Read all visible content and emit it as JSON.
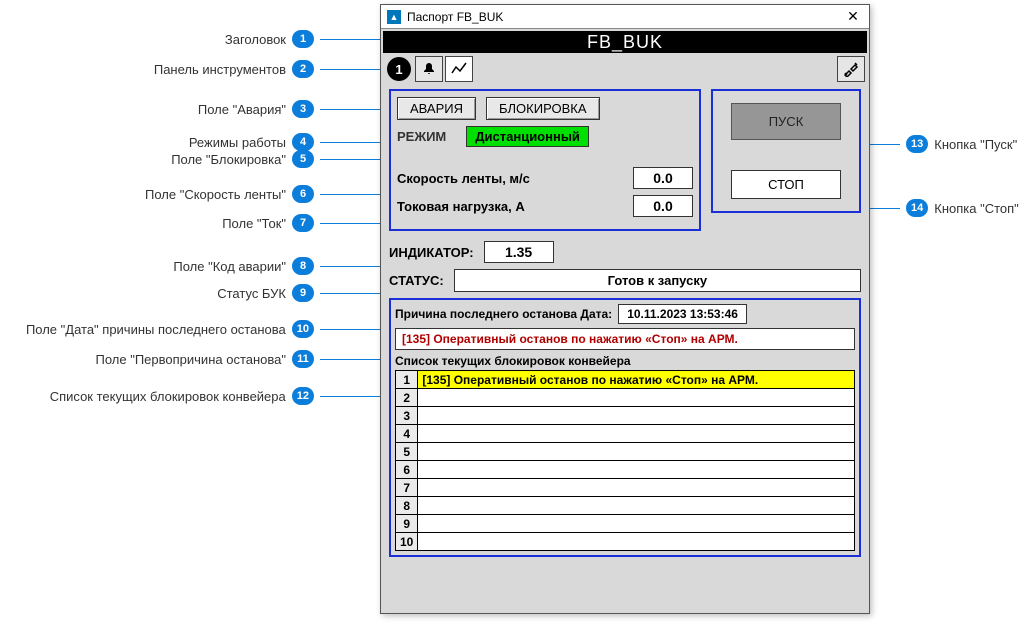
{
  "callouts_left": [
    {
      "num": "1",
      "label": "Заголовок"
    },
    {
      "num": "2",
      "label": "Панель инструментов"
    },
    {
      "num": "3",
      "label": "Поле \"Авария\""
    },
    {
      "num": "4",
      "label": "Режимы работы"
    },
    {
      "num": "5",
      "label": "Поле \"Блокировка\""
    },
    {
      "num": "6",
      "label": "Поле \"Скорость ленты\""
    },
    {
      "num": "7",
      "label": "Поле \"Ток\""
    },
    {
      "num": "8",
      "label": "Поле \"Код аварии\""
    },
    {
      "num": "9",
      "label": "Статус БУК"
    },
    {
      "num": "10",
      "label": "Поле \"Дата\" причины последнего останова"
    },
    {
      "num": "11",
      "label": "Поле \"Первопричина останова\""
    },
    {
      "num": "12",
      "label": "Список текущих блокировок конвейера"
    }
  ],
  "callouts_right": [
    {
      "num": "13",
      "label": "Кнопка \"Пуск\""
    },
    {
      "num": "14",
      "label": "Кнопка \"Стоп\""
    }
  ],
  "window": {
    "title": "Паспорт FB_BUK",
    "header": "FB_BUK",
    "toolbar": {
      "circle_num": "1"
    },
    "alarm_btn": "АВАРИЯ",
    "block_btn": "БЛОКИРОВКА",
    "mode_label": "РЕЖИМ",
    "mode_value": "Дистанционный",
    "speed_label": "Скорость ленты, м/с",
    "speed_value": "0.0",
    "current_label": "Токовая нагрузка, А",
    "current_value": "0.0",
    "start_btn": "ПУСК",
    "stop_btn": "СТОП",
    "indicator_label": "ИНДИКАТОР:",
    "indicator_value": "1.35",
    "status_label": "СТАТУС:",
    "status_value": "Готов к запуску",
    "reason_header": "Причина последнего останова  Дата:",
    "reason_date": "10.11.2023 13:53:46",
    "reason_text": "[135] Оперативный останов по нажатию «Стоп» на АРМ.",
    "interlock_title": "Список текущих блокировок конвейера",
    "interlock_rows": [
      {
        "n": "1",
        "text": "[135] Оперативный останов по нажатию «Стоп» на АРМ.",
        "hl": true
      },
      {
        "n": "2",
        "text": ""
      },
      {
        "n": "3",
        "text": ""
      },
      {
        "n": "4",
        "text": ""
      },
      {
        "n": "5",
        "text": ""
      },
      {
        "n": "6",
        "text": ""
      },
      {
        "n": "7",
        "text": ""
      },
      {
        "n": "8",
        "text": ""
      },
      {
        "n": "9",
        "text": ""
      },
      {
        "n": "10",
        "text": ""
      }
    ]
  }
}
